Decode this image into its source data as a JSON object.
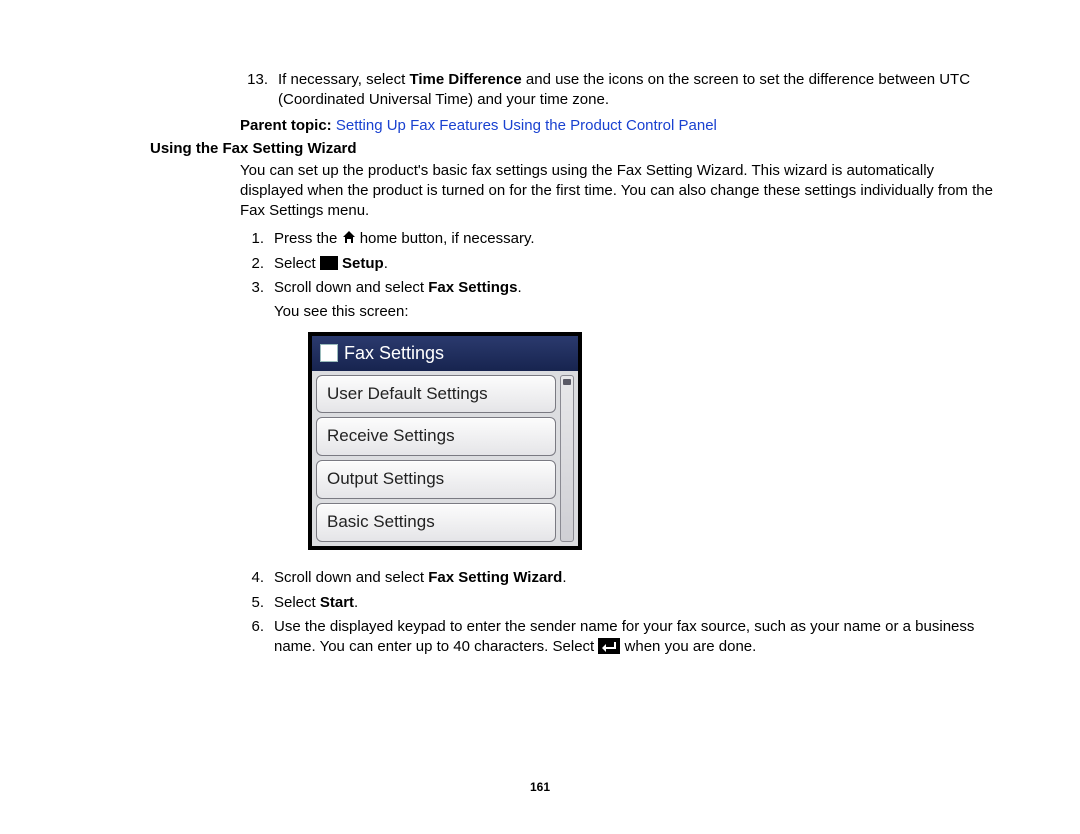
{
  "top_step": {
    "num": "13.",
    "text_before": "If necessary, select ",
    "bold": "Time Difference",
    "text_after": " and use the icons on the screen to set the difference between UTC (Coordinated Universal Time) and your time zone."
  },
  "parent_topic": {
    "label": "Parent topic:",
    "link": "Setting Up Fax Features Using the Product Control Panel"
  },
  "section_heading": "Using the Fax Setting Wizard",
  "section_intro": "You can set up the product's basic fax settings using the Fax Setting Wizard. This wizard is automatically displayed when the product is turned on for the first time. You can also change these settings individually from the Fax Settings menu.",
  "steps": {
    "s1": {
      "num": "1.",
      "before": "Press the ",
      "after": " home button, if necessary."
    },
    "s2": {
      "num": "2.",
      "before": "Select ",
      "bold": "Setup",
      "after": "."
    },
    "s3": {
      "num": "3.",
      "before": "Scroll down and select ",
      "bold": "Fax Settings",
      "after": ".",
      "note": "You see this screen:"
    },
    "s4": {
      "num": "4.",
      "before": "Scroll down and select ",
      "bold": "Fax Setting Wizard",
      "after": "."
    },
    "s5": {
      "num": "5.",
      "before": "Select ",
      "bold": "Start",
      "after": "."
    },
    "s6": {
      "num": "6.",
      "before": "Use the displayed keypad to enter the sender name for your fax source, such as your name or a business name. You can enter up to 40 characters. Select ",
      "after": " when you are done."
    }
  },
  "fax_screen": {
    "title": "Fax Settings",
    "items": [
      "User Default Settings",
      "Receive Settings",
      "Output Settings",
      "Basic Settings"
    ]
  },
  "page_number": "161"
}
